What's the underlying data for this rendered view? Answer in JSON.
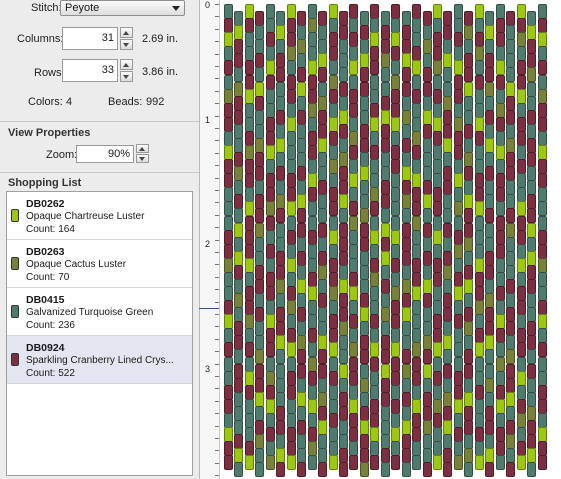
{
  "design": {
    "stitch_label": "Stitch:",
    "stitch_value": "Peyote",
    "columns_label": "Columns:",
    "columns_value": "31",
    "columns_inches": "2.69 in.",
    "rows_label": "Rows:",
    "rows_value": "33",
    "rows_inches": "3.86 in.",
    "colors_label": "Colors:",
    "colors_value": "4",
    "beads_label": "Beads:",
    "beads_value": "992"
  },
  "view": {
    "title": "View Properties",
    "zoom_label": "Zoom:",
    "zoom_value": "90%"
  },
  "shopping": {
    "title": "Shopping List",
    "items": [
      {
        "code": "DB0262",
        "name": "Opaque Chartreuse Luster",
        "count": "Count: 164",
        "color": "#9cc813"
      },
      {
        "code": "DB0263",
        "name": "Opaque Cactus Luster",
        "count": "Count: 70",
        "color": "#77813a"
      },
      {
        "code": "DB0415",
        "name": "Galvanized Turquoise Green",
        "count": "Count: 236",
        "color": "#4f7a6e"
      },
      {
        "code": "DB0924",
        "name": "Sparkling Cranberry Lined Crys...",
        "count": "Count: 522",
        "color": "#7b2f40"
      }
    ]
  },
  "ruler": {
    "labels": [
      "0",
      "1",
      "2",
      "3"
    ]
  },
  "pattern": {
    "bead_colors": {
      "C": "#9cc813",
      "K": "#77813a",
      "T": "#4f7a6e",
      "R": "#7b2f40"
    }
  }
}
